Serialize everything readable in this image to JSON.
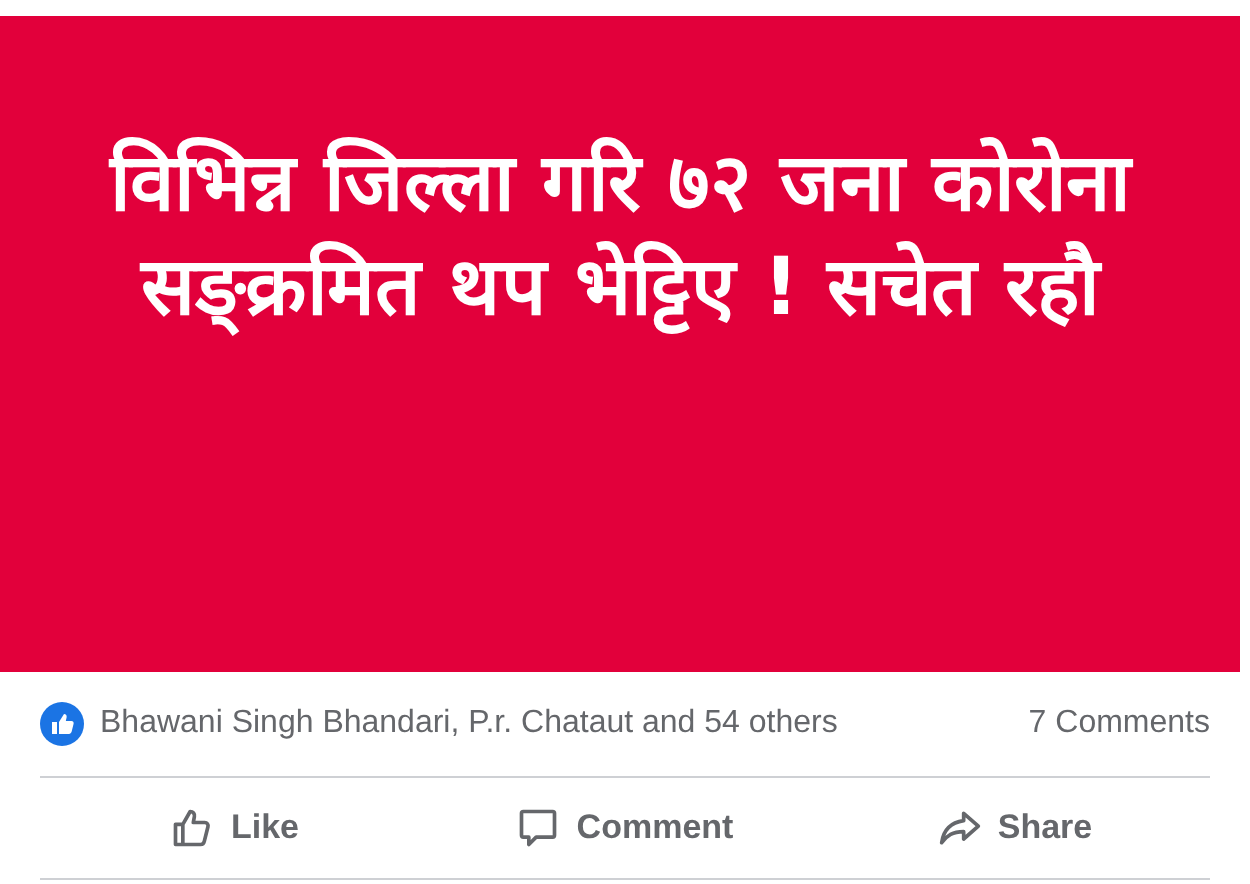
{
  "post": {
    "headline": "विभिन्न जिल्ला गरि ७२ जना कोरोना सङ्क्रमित थप भेट्टिए ! सचेत रहौ"
  },
  "reactions": {
    "summary": "Bhawani Singh Bhandari, P.r. Chataut and 54 others",
    "comments": "7 Comments"
  },
  "actions": [
    {
      "kind": "like",
      "label": "Like"
    },
    {
      "kind": "comment",
      "label": "Comment"
    },
    {
      "kind": "share",
      "label": "Share"
    }
  ]
}
